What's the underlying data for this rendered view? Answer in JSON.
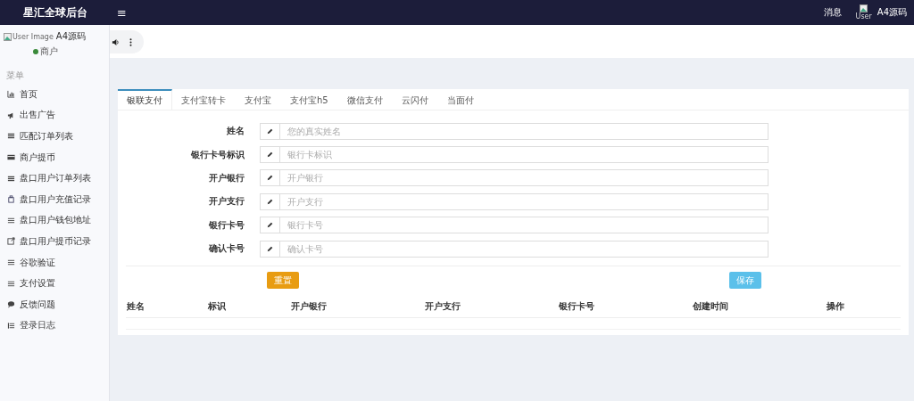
{
  "topbar": {
    "brand": "星汇全球后台",
    "menu_glyph": "≡",
    "messages": "消息",
    "user_image_alt": "User",
    "user_name": "A4源码"
  },
  "user_panel": {
    "image_alt": "User Image",
    "name": "A4源码",
    "status": "商户"
  },
  "sidebar": {
    "heading": "菜单",
    "items": [
      {
        "label": "首页"
      },
      {
        "label": "出售广告"
      },
      {
        "label": "匹配订单列表"
      },
      {
        "label": "商户提币"
      },
      {
        "label": "盘口用户订单列表"
      },
      {
        "label": "盘口用户充值记录"
      },
      {
        "label": "盘口用户钱包地址"
      },
      {
        "label": "盘口用户提币记录"
      },
      {
        "label": "谷歌验证"
      },
      {
        "label": "支付设置"
      },
      {
        "label": "反馈问题"
      },
      {
        "label": "登录日志"
      }
    ]
  },
  "tabs": [
    {
      "label": "银联支付",
      "selected": true
    },
    {
      "label": "支付宝转卡",
      "selected": false
    },
    {
      "label": "支付宝",
      "selected": false
    },
    {
      "label": "支付宝h5",
      "selected": false
    },
    {
      "label": "微信支付",
      "selected": false
    },
    {
      "label": "云闪付",
      "selected": false
    },
    {
      "label": "当面付",
      "selected": false
    }
  ],
  "form": {
    "fields": [
      {
        "label": "姓名",
        "placeholder": "您的真实姓名"
      },
      {
        "label": "银行卡号标识",
        "placeholder": "银行卡标识"
      },
      {
        "label": "开户银行",
        "placeholder": "开户银行"
      },
      {
        "label": "开户支行",
        "placeholder": "开户支行"
      },
      {
        "label": "银行卡号",
        "placeholder": "银行卡号"
      },
      {
        "label": "确认卡号",
        "placeholder": "确认卡号"
      }
    ],
    "buttons": [
      {
        "kind": "reset",
        "label": "重置"
      },
      {
        "kind": "save",
        "label": "保存"
      }
    ]
  },
  "table": {
    "columns": [
      "姓名",
      "标识",
      "开户银行",
      "开户支行",
      "银行卡号",
      "创建时间",
      "操作"
    ]
  }
}
